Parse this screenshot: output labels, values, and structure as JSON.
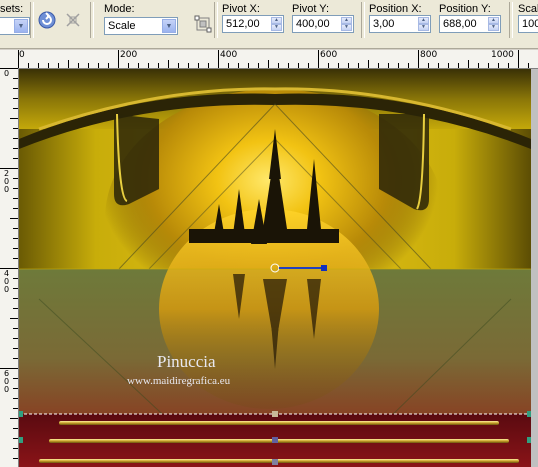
{
  "toolbar": {
    "presets_label": "sets:",
    "mode_label": "Mode:",
    "mode_value": "Scale",
    "pivot_x_label": "Pivot X:",
    "pivot_x_value": "512,00",
    "pivot_y_label": "Pivot Y:",
    "pivot_y_value": "400,00",
    "position_x_label": "Position X:",
    "position_x_value": "3,00",
    "position_y_label": "Position Y:",
    "position_y_value": "688,00",
    "scale_label": "Scal",
    "scale_value": "100"
  },
  "ruler": {
    "h_labels": [
      "0",
      "200",
      "400",
      "600",
      "800",
      "1000"
    ],
    "v_labels": [
      "0",
      "200",
      "400",
      "600"
    ]
  },
  "image": {
    "watermark_title": "Pinuccia",
    "watermark_url": "www.maidiregrafica.eu"
  },
  "icons": {
    "apply": "apply-icon",
    "reset": "reset-icon",
    "tool": "deform-tool-icon",
    "stepper": "spin-stepper-icon",
    "dropdown": "chevron-down-icon"
  }
}
